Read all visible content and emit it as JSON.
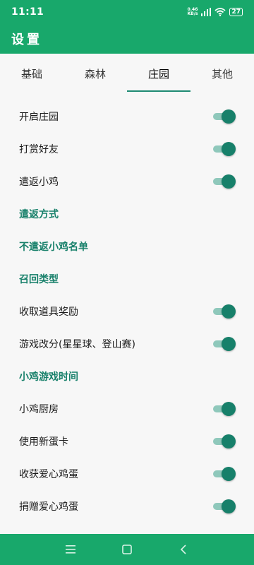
{
  "status": {
    "time": "11:11",
    "net_speed_value": "0.46",
    "net_speed_unit": "KB/s",
    "battery": "27"
  },
  "header": {
    "title": "设置"
  },
  "tabs": [
    {
      "label": "基础"
    },
    {
      "label": "森林"
    },
    {
      "label": "庄园",
      "active": true
    },
    {
      "label": "其他"
    }
  ],
  "settings": [
    {
      "label": "开启庄园",
      "type": "toggle",
      "on": true
    },
    {
      "label": "打赏好友",
      "type": "toggle",
      "on": true
    },
    {
      "label": "遣返小鸡",
      "type": "toggle",
      "on": true
    },
    {
      "label": "遣返方式",
      "type": "section"
    },
    {
      "label": "不遣返小鸡名单",
      "type": "section"
    },
    {
      "label": "召回类型",
      "type": "section"
    },
    {
      "label": "收取道具奖励",
      "type": "toggle",
      "on": true
    },
    {
      "label": "游戏改分(星星球、登山赛)",
      "type": "toggle",
      "on": true
    },
    {
      "label": "小鸡游戏时间",
      "type": "section"
    },
    {
      "label": "小鸡厨房",
      "type": "toggle",
      "on": true
    },
    {
      "label": "使用新蛋卡",
      "type": "toggle",
      "on": true
    },
    {
      "label": "收获爱心鸡蛋",
      "type": "toggle",
      "on": true
    },
    {
      "label": "捐赠爱心鸡蛋",
      "type": "toggle",
      "on": true
    }
  ],
  "colors": {
    "primary": "#18a86b",
    "accent": "#17806a",
    "toggle_track": "#8fc8bb"
  },
  "icons": {
    "wifi": "wifi-icon",
    "signal": "signal-icon",
    "nav_menu": "menu-icon",
    "nav_home": "home-square-icon",
    "nav_back": "back-chevron-icon"
  }
}
